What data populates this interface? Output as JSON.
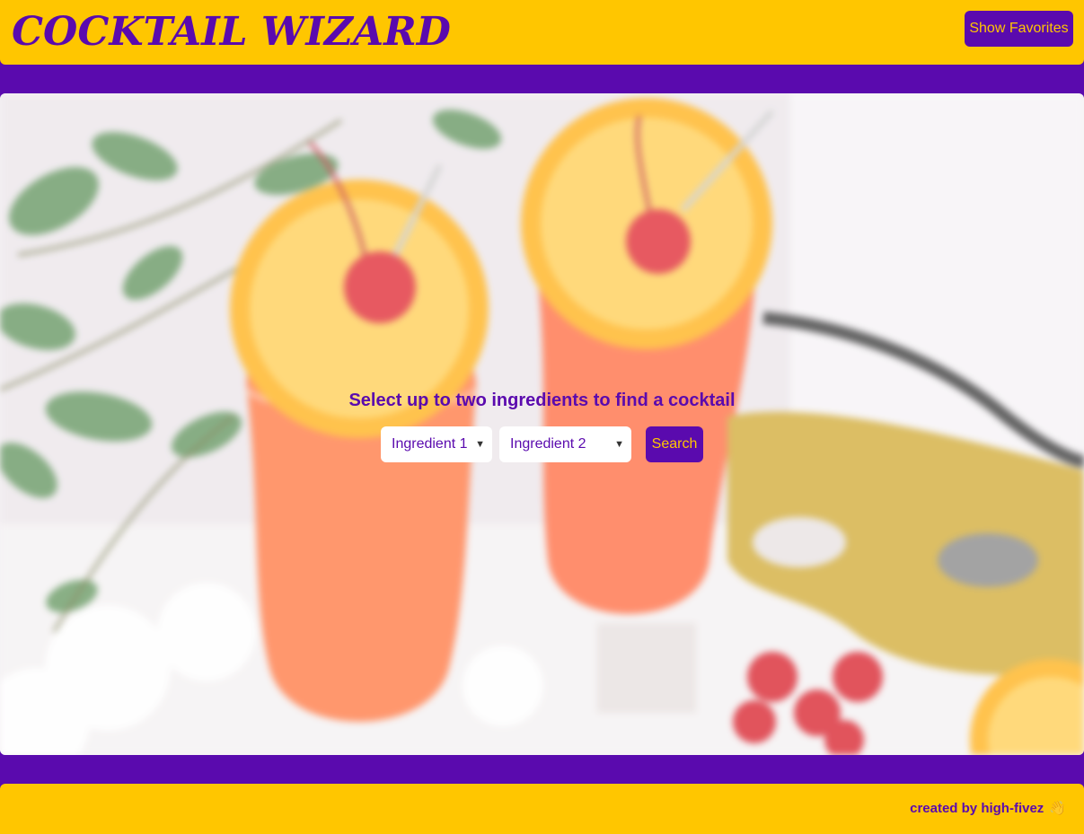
{
  "header": {
    "title": "COCKTAIL WIZARD",
    "favorites_button": "Show Favorites"
  },
  "hero": {
    "background_image": "blurred-hurricane-cocktails-photo",
    "prompt": "Select up to two ingredients to find a cocktail",
    "ingredient_1": {
      "selected": "Ingredient 1"
    },
    "ingredient_2": {
      "selected": "Ingredient 2"
    },
    "search_button": "Search"
  },
  "footer": {
    "credit": "created by high-fivez",
    "credit_icon": "waving-hand-icon"
  },
  "colors": {
    "brand_purple": "#5a0aae",
    "brand_yellow": "#ffc600"
  }
}
